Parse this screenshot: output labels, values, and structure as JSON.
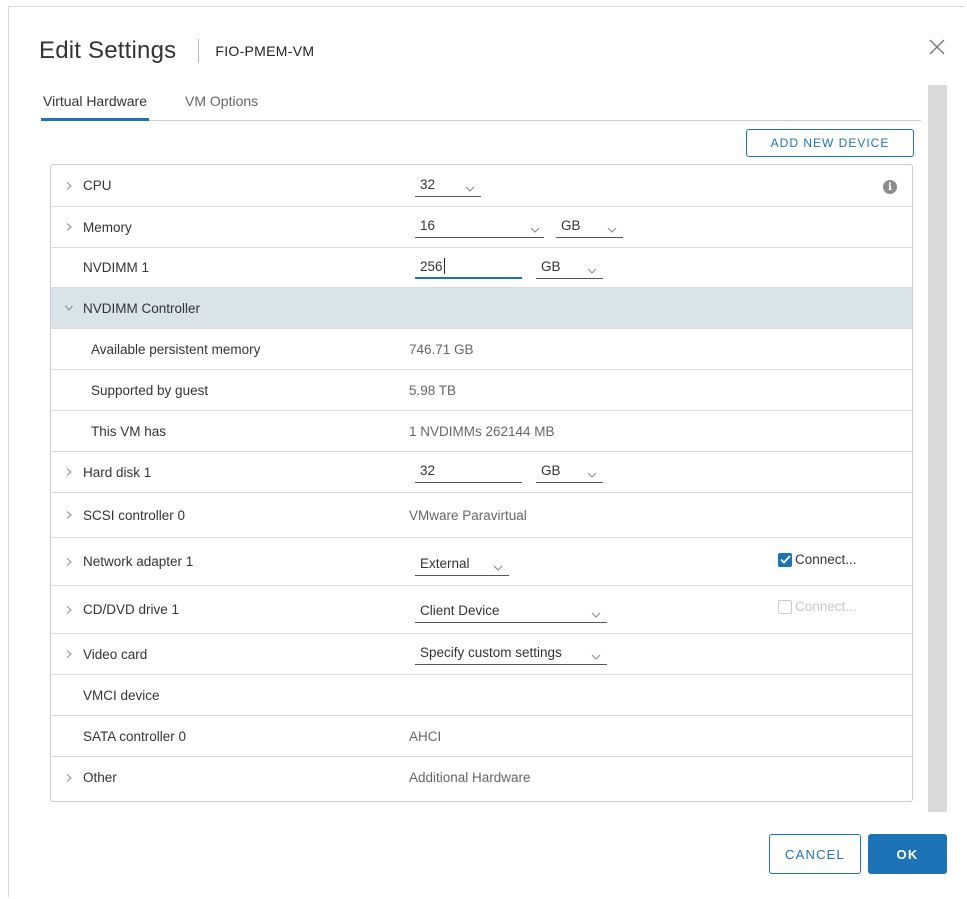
{
  "dialog": {
    "title": "Edit Settings",
    "subtitle": "FIO-PMEM-VM"
  },
  "icons": {
    "close": "close-icon",
    "info": "info-icon",
    "chevron_right": "chevron-right-icon",
    "chevron_down": "chevron-down-icon",
    "checkbox": "checkbox-icon"
  },
  "tabs": [
    {
      "label": "Virtual Hardware",
      "active": true
    },
    {
      "label": "VM Options",
      "active": false
    }
  ],
  "toolbar": {
    "add_device": "ADD NEW DEVICE"
  },
  "rows": {
    "cpu": {
      "label": "CPU",
      "value": "32",
      "info": "i"
    },
    "memory": {
      "label": "Memory",
      "value": "16",
      "unit": "GB"
    },
    "nvdimm1": {
      "label": "NVDIMM 1",
      "value": "256",
      "unit": "GB"
    },
    "nvdimm_controller": {
      "label": "NVDIMM Controller"
    },
    "available_pmem": {
      "label": "Available persistent memory",
      "value": "746.71 GB"
    },
    "supported_guest": {
      "label": "Supported by guest",
      "value": "5.98 TB"
    },
    "this_vm_has": {
      "label": "This VM has",
      "value": "1 NVDIMMs 262144 MB"
    },
    "hard_disk1": {
      "label": "Hard disk 1",
      "value": "32",
      "unit": "GB"
    },
    "scsi0": {
      "label": "SCSI controller 0",
      "value": "VMware Paravirtual"
    },
    "net1": {
      "label": "Network adapter 1",
      "value": "External",
      "connect": "Connect...",
      "connected": true
    },
    "cdvd1": {
      "label": "CD/DVD drive 1",
      "value": "Client Device",
      "connect": "Connect...",
      "connected": false
    },
    "video": {
      "label": "Video card",
      "value": "Specify custom settings"
    },
    "vmci": {
      "label": "VMCI device"
    },
    "sata0": {
      "label": "SATA controller 0",
      "value": "AHCI"
    },
    "other": {
      "label": "Other",
      "value": "Additional Hardware"
    }
  },
  "footer": {
    "cancel": "CANCEL",
    "ok": "OK"
  },
  "colors": {
    "accent": "#1d73b6",
    "row_highlight": "#d8e3ea",
    "border": "#cccccc"
  }
}
